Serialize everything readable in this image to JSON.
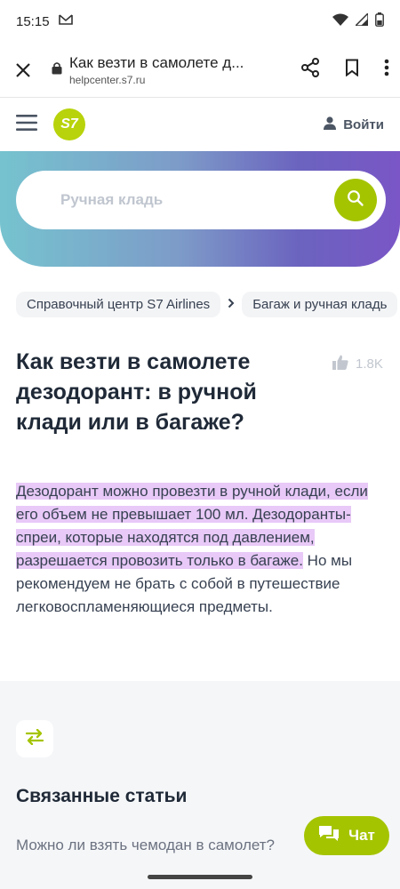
{
  "status_bar": {
    "time": "15:15"
  },
  "browser": {
    "page_title": "Как везти в самолете д...",
    "domain": "helpcenter.s7.ru"
  },
  "header": {
    "logo_text": "S7",
    "login_label": "Войти"
  },
  "search": {
    "placeholder": "Ручная кладь"
  },
  "breadcrumb": [
    {
      "label": "Справочный центр S7 Airlines"
    },
    {
      "label": "Багаж и ручная кладь"
    }
  ],
  "article": {
    "title": "Как везти в самолете дезодорант: в ручной клади или в багаже?",
    "likes": "1.8K",
    "highlighted": "Дезодорант можно провезти в ручной клади, если его объем не превышает 100 мл. Дезодоранты-спреи, которые находятся под давлением, разрешается провозить только в багаже.",
    "rest": " Но мы рекомендуем не брать с собой в путешествие легковоспламеняющиеся предметы."
  },
  "related": {
    "title": "Связанные статьи",
    "items": [
      {
        "label": "Можно ли взять чемодан в самолет?"
      }
    ]
  },
  "chat": {
    "label": "Чат"
  },
  "colors": {
    "accent": "#a4c400",
    "highlight": "#e8c9f7",
    "hero_gradient_start": "#76c3cf",
    "hero_gradient_end": "#7a56c6"
  },
  "icons": {
    "status": [
      "gmail-icon",
      "wifi-icon",
      "signal-icon",
      "battery-icon"
    ],
    "browser": [
      "close-icon",
      "lock-icon",
      "share-icon",
      "bookmark-icon",
      "more-vert-icon"
    ],
    "header": [
      "hamburger-menu-icon",
      "user-icon"
    ],
    "search": "search-icon",
    "likes": "thumbs-up-icon",
    "related": "swap-arrows-icon",
    "chat": "chat-bubble-icon"
  }
}
